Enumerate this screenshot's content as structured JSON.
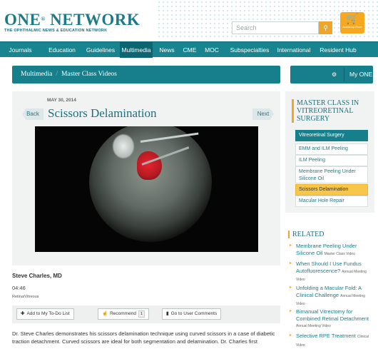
{
  "header": {
    "logo_main": "ONE",
    "logo_reg": "®",
    "logo_network": "NETWORK",
    "logo_sub": "THE OPHTHALMIC NEWS & EDUCATION NETWORK",
    "search_placeholder": "Search",
    "cart_label": "Academy Store"
  },
  "nav": {
    "items": [
      {
        "label": "Journals"
      },
      {
        "label": "Education"
      },
      {
        "label": "Guidelines"
      },
      {
        "label": "Multimedia",
        "active": true
      },
      {
        "label": "News"
      },
      {
        "label": "CME"
      },
      {
        "label": "MOC"
      },
      {
        "label": "Subspecialties"
      },
      {
        "label": "International"
      },
      {
        "label": "Resident Hub"
      }
    ]
  },
  "breadcrumb": {
    "root": "Multimedia",
    "separator": "/",
    "current": "Master Class Videos"
  },
  "myone": {
    "label": "My ONE",
    "gear_icon": "gear-icon"
  },
  "article": {
    "date": "MAY 30, 2014",
    "back_label": "Back",
    "next_label": "Next",
    "title": "Scissors Delamination",
    "author": "Steve Charles, MD",
    "duration": "04:46",
    "category": "Retina/Vitreous",
    "description": "Dr. Steve Charles demonstrates his scissors delamination technique using curved scissors in a case of diabetic traction detachment. Curved scissors are ideal for both segmentation and delamination. Dr. Charles first"
  },
  "toolbar": {
    "todo_label": "Add to My To-Do List",
    "recommend_label": "Recommend",
    "recommend_count": "1",
    "comments_label": "Go to User Comments"
  },
  "sidebar": {
    "heading": "MASTER CLASS IN VITREORETINAL SURGERY",
    "items": [
      {
        "label": "Vitreoretinal Surgery",
        "state": "header"
      },
      {
        "label": "EMM and ILM Peeling"
      },
      {
        "label": "ILM Peeling"
      },
      {
        "label": "Membrane Peeling Under Silicone Oil"
      },
      {
        "label": "Scissors Delamination",
        "state": "selected"
      },
      {
        "label": "Macular Hole Repair"
      }
    ]
  },
  "related": {
    "heading": "RELATED",
    "items": [
      {
        "title": "Membrane Peeling Under Silicone Oil",
        "type": "Master Class Video"
      },
      {
        "title": "When Should I Use Fundus Autofluorescence?",
        "type": "Annual Meeting Video"
      },
      {
        "title": "Unfolding a Macular Fold: A Clinical Challenge",
        "type": "Annual Meeting Video"
      },
      {
        "title": "Bimanual Vitrectomy for Combined Retinal Detachment",
        "type": "Annual Meeting Video"
      },
      {
        "title": "Selective RPE Treatment",
        "type": "Clinical Video"
      }
    ]
  },
  "colors": {
    "brand_teal": "#177f8c",
    "accent_orange": "#f1a42a",
    "selected_yellow": "#f8c64a"
  }
}
